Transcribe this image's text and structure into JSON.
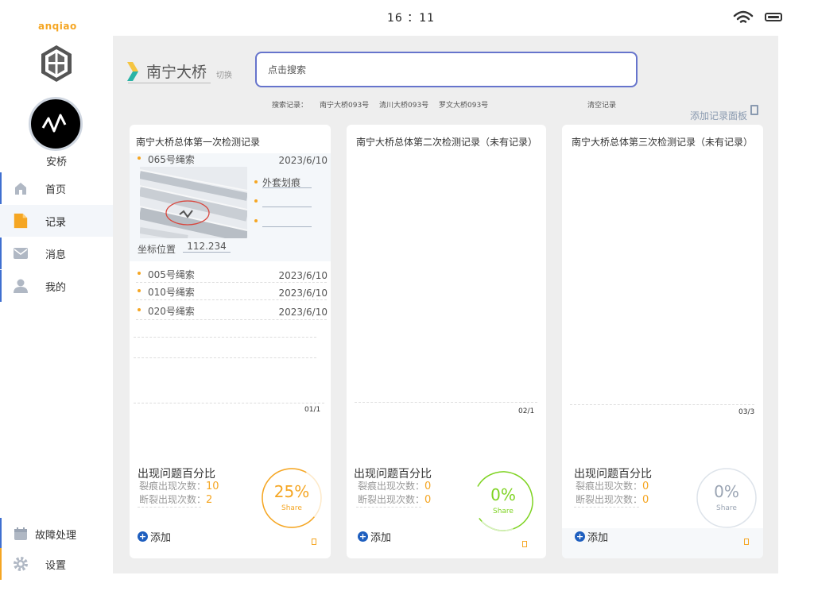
{
  "status_bar": {
    "time": "16 ：11"
  },
  "sidebar": {
    "brand": "anqiao",
    "user_name": "安桥",
    "nav": [
      {
        "label": "首页",
        "icon": "home-icon"
      },
      {
        "label": "记录",
        "icon": "document-icon"
      },
      {
        "label": "消息",
        "icon": "mail-icon"
      },
      {
        "label": "我的",
        "icon": "user-icon"
      }
    ],
    "bottom_nav": [
      {
        "label": "故障处理",
        "icon": "calendar-icon"
      },
      {
        "label": "设置",
        "icon": "gear-icon"
      }
    ]
  },
  "header": {
    "bridge_name": "南宁大桥",
    "switch_label": "切换",
    "search_placeholder": "点击搜索",
    "history_label": "搜索记录：",
    "history_items": [
      "南宁大桥093号",
      "清川大桥093号",
      "罗文大桥093号"
    ],
    "clear_history": "清空记录",
    "add_panel": "添加记录面板"
  },
  "cards": [
    {
      "title": "南宁大桥总体第一次检测记录",
      "expanded": {
        "name": "065号绳索",
        "date": "2023/6/10",
        "issues": [
          "外套划痕",
          "",
          ""
        ],
        "coord_label": "坐标位置",
        "coord_value": "112.234"
      },
      "records": [
        {
          "name": "005号绳索",
          "date": "2023/6/10"
        },
        {
          "name": "010号绳索",
          "date": "2023/6/10"
        },
        {
          "name": "020号绳索",
          "date": "2023/6/10"
        }
      ],
      "page": "01/1",
      "stat_title": "出现问题百分比",
      "crack_label": "裂痕出现次数：",
      "crack_count": "10",
      "break_label": "断裂出现次数：",
      "break_count": "2",
      "percent": "25%",
      "percent_value": 0.25,
      "share": "Share",
      "ring_color": "#f5a623",
      "add_label": "添加"
    },
    {
      "title": "南宁大桥总体第二次检测记录（未有记录）",
      "page": "02/1",
      "stat_title": "出现问题百分比",
      "crack_label": "裂痕出现次数：",
      "crack_count": "0",
      "break_label": "断裂出现次数：",
      "break_count": "0",
      "percent": "0%",
      "percent_value": 0,
      "share": "Share",
      "ring_color": "#7ed321",
      "add_label": "添加"
    },
    {
      "title": "南宁大桥总体第三次检测记录（未有记录）",
      "page": "03/3",
      "stat_title": "出现问题百分比",
      "crack_label": "裂痕出现次数：",
      "crack_count": "0",
      "break_label": "断裂出现次数：",
      "break_count": "0",
      "percent": "0%",
      "percent_value": 0,
      "share": "Share",
      "ring_color": "#b0b8c4",
      "add_label": "添加"
    }
  ],
  "colors": {
    "accent": "#f5a623",
    "primary": "#6674cc",
    "link": "#1f5fbf"
  }
}
